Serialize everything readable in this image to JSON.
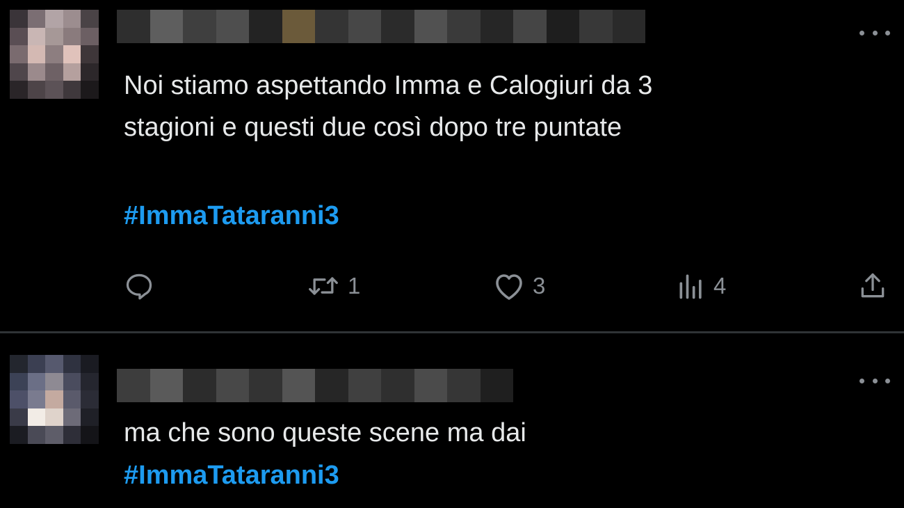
{
  "tweets": [
    {
      "text": "Noi stiamo aspettando Imma e Calogiuri da 3\nstagioni e questi due così dopo tre puntate",
      "hashtag": "#ImmaTataranni3",
      "retweets": "1",
      "likes": "3",
      "views": "4"
    },
    {
      "text": "ma che sono queste scene ma dai",
      "hashtag": "#ImmaTataranni3"
    }
  ],
  "colors": {
    "background": "#000000",
    "text": "#e7e9ea",
    "hashtag": "#1d9bf0",
    "icon": "#8b9096",
    "divider": "#2f3336"
  },
  "icons": [
    "reply-icon",
    "retweet-icon",
    "like-icon",
    "views-icon",
    "share-icon",
    "more-icon"
  ]
}
